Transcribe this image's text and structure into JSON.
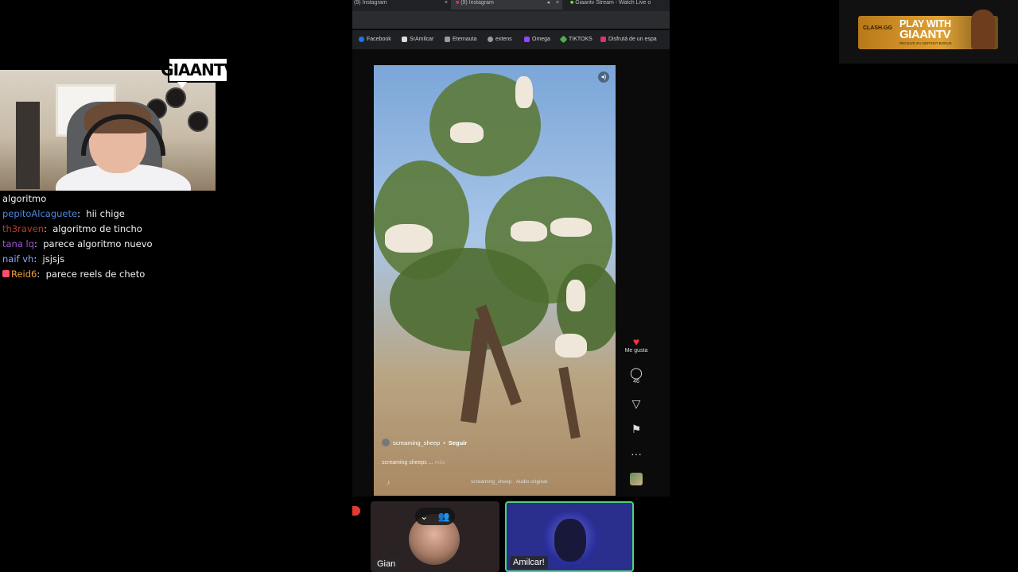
{
  "overlay": {
    "cam_logo": "GIAANTV"
  },
  "chat": [
    {
      "user": "",
      "text": "algoritmo",
      "color": "#ffffff",
      "heart": false
    },
    {
      "user": "pepitoAlcaguete",
      "text": "hii chige",
      "color": "#4f86d9",
      "heart": false
    },
    {
      "user": "th3raven",
      "text": "algoritmo de tincho",
      "color": "#c0392b",
      "heart": false
    },
    {
      "user": "tana lq",
      "text": "parece algoritmo nuevo",
      "color": "#9b59d0",
      "heart": false
    },
    {
      "user": "naif vh",
      "text": "jsjsjs",
      "color": "#8fa8ff",
      "heart": false
    },
    {
      "user": "Reid6",
      "text": "parece reels de cheto",
      "color": "#f0a23a",
      "heart": true
    }
  ],
  "browser": {
    "tabs": [
      {
        "label": "(9) Instagram",
        "active": false
      },
      {
        "label": "(9) Instagram",
        "active": true
      },
      {
        "label": "Giaantv Stream - Watch Live o",
        "active": false
      }
    ],
    "bookmarks": [
      {
        "label": "Facebook",
        "color": "#1877f2"
      },
      {
        "label": "SrAmilcar",
        "color": "#ffffff"
      },
      {
        "label": "Eternauta",
        "color": "#bbbbbb"
      },
      {
        "label": "extens",
        "color": "#bbbbbb"
      },
      {
        "label": "Omega",
        "color": "#9146ff"
      },
      {
        "label": "TIKTOKS",
        "color": "#4caf50"
      },
      {
        "label": "Disfrutá de un espa",
        "color": "#e1306c"
      }
    ]
  },
  "reel": {
    "username": "screaming_sheep",
    "follow_label": "Seguir",
    "caption": "screaming sheeps ...",
    "more_label": "más",
    "audio": "screaming_sheep · Audio original",
    "like_label": "Me gusta",
    "comments_count": "46",
    "icons": {
      "like": "heart-icon",
      "comment": "comment-icon",
      "share": "share-icon",
      "save": "bookmark-icon",
      "more": "more-icon",
      "audio": "music-note-icon",
      "mute": "speaker-icon"
    }
  },
  "participants": [
    {
      "name": "Gian",
      "active": false
    },
    {
      "name": "Amilcar!",
      "active": true
    }
  ],
  "ad": {
    "brand": "CLASH.GG",
    "line1": "PLAY WITH",
    "line2": "GIAANTV",
    "sub": "RECEIVE 5% DEPOSIT BONUS"
  },
  "colors": {
    "like": "#ff3040",
    "active_border": "#4fd17a"
  }
}
